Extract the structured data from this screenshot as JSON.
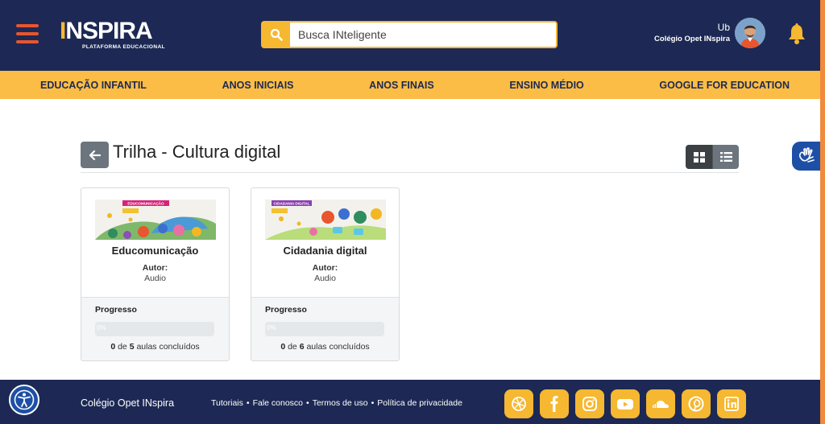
{
  "colors": {
    "navy": "#1d2954",
    "yellow": "#fbbd45",
    "accent_orange": "#e8552e",
    "a11y_blue": "#1e4fa6"
  },
  "header": {
    "logo": {
      "brand": "NSPIRA",
      "brand_prefix": "I",
      "subtitle": "PLATAFORMA EDUCACIONAL"
    },
    "search": {
      "placeholder": "Busca INteligente"
    },
    "user": {
      "name": "Ub",
      "school": "Colégio Opet INspira"
    }
  },
  "nav": {
    "items": [
      "EDUCAÇÃO INFANTIL",
      "ANOS INICIAIS",
      "ANOS FINAIS",
      "ENSINO MÉDIO",
      "GOOGLE FOR EDUCATION"
    ]
  },
  "main": {
    "title": "Trilha - Cultura digital",
    "cards": [
      {
        "title": "Educomunicação",
        "image_tag": "EDUCOMUNICAÇÃO",
        "author_label": "Autor:",
        "author": "Audio",
        "progress_label": "Progresso",
        "progress_text": "0%",
        "progress": 0,
        "done": "0",
        "total": "5",
        "count_suffix": "aulas concluídos"
      },
      {
        "title": "Cidadania digital",
        "image_tag": "CIDADANIA DIGITAL",
        "author_label": "Autor:",
        "author": "Audio",
        "progress_label": "Progresso",
        "progress_text": "0%",
        "progress": 0,
        "done": "0",
        "total": "6",
        "count_suffix": "aulas concluídos"
      }
    ]
  },
  "footer": {
    "brand": "Colégio Opet INspira",
    "links": [
      "Tutoriais",
      "Fale conosco",
      "Termos de uso",
      "Política de privacidade"
    ],
    "separator": "•",
    "socials": [
      "globe-icon",
      "facebook-icon",
      "instagram-icon",
      "youtube-icon",
      "soundcloud-icon",
      "pinterest-icon",
      "linkedin-icon"
    ]
  },
  "icons": {
    "menu": "hamburger-menu-icon",
    "search": "search-icon",
    "bell": "bell-icon",
    "back": "arrow-left-icon",
    "grid_view": "grid-icon",
    "list_view": "list-icon",
    "sign_language": "sign-language-icon",
    "accessibility": "accessibility-icon"
  }
}
